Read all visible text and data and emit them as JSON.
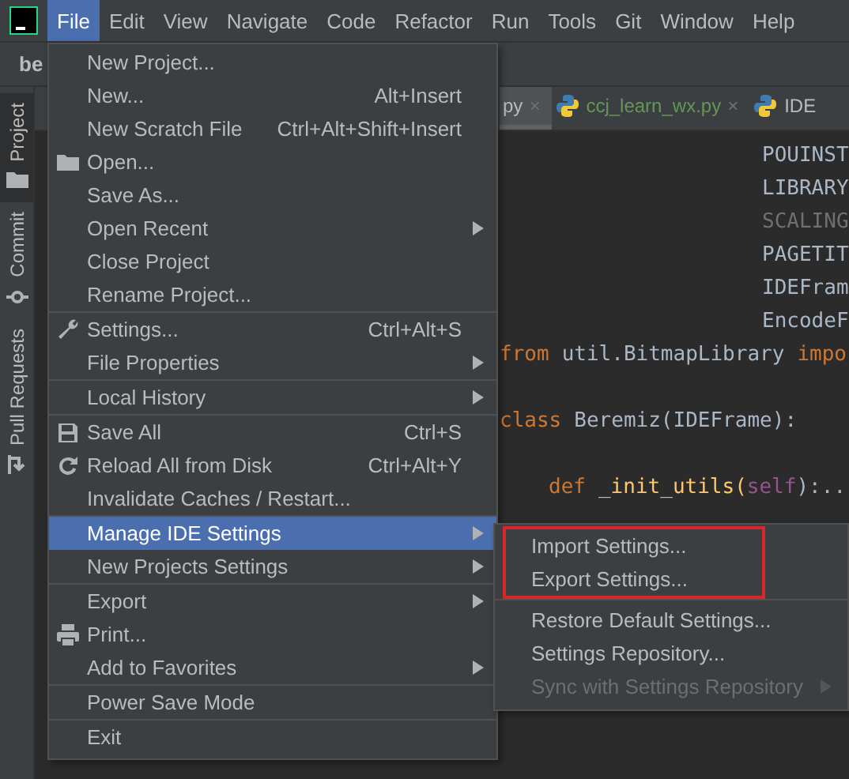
{
  "menubar": [
    {
      "label": "File",
      "selected": true
    },
    {
      "label": "Edit",
      "selected": false
    },
    {
      "label": "View",
      "selected": false
    },
    {
      "label": "Navigate",
      "selected": false
    },
    {
      "label": "Code",
      "selected": false
    },
    {
      "label": "Refactor",
      "selected": false
    },
    {
      "label": "Run",
      "selected": false
    },
    {
      "label": "Tools",
      "selected": false
    },
    {
      "label": "Git",
      "selected": false
    },
    {
      "label": "Window",
      "selected": false
    },
    {
      "label": "Help",
      "selected": false
    }
  ],
  "navbar": {
    "project": "be"
  },
  "sidebar": [
    {
      "label": "Project",
      "selected": true
    },
    {
      "label": "Commit",
      "selected": false
    },
    {
      "label": "Pull Requests",
      "selected": false
    }
  ],
  "tabs": [
    {
      "label": "py",
      "close": "×",
      "selected": true,
      "color": "#bbbbbb"
    },
    {
      "label": "ccj_learn_wx.py",
      "close": "×",
      "selected": false,
      "color": "#629755"
    },
    {
      "label": "IDE",
      "selected": false,
      "color": "#bbbbbb"
    }
  ],
  "code": [
    {
      "kind": "cut",
      "tokens": [
        {
          "kind": "plain",
          "text": "POUINST"
        }
      ]
    },
    {
      "kind": "cut",
      "tokens": [
        {
          "kind": "plain",
          "text": "LIBRARY"
        }
      ]
    },
    {
      "kind": "cut",
      "tokens": [
        {
          "kind": "dim",
          "text": "SCALING"
        }
      ]
    },
    {
      "kind": "cut",
      "tokens": [
        {
          "kind": "plain",
          "text": "PAGETIT"
        }
      ]
    },
    {
      "kind": "cut",
      "tokens": [
        {
          "kind": "plain",
          "text": "IDEFram"
        }
      ]
    },
    {
      "kind": "cut",
      "tokens": [
        {
          "kind": "plain",
          "text": "EncodeF"
        }
      ]
    },
    {
      "kind": "full",
      "tokens": [
        {
          "kind": "keyword",
          "text": "from"
        },
        {
          "kind": "plain",
          "text": "util.BitmapLibrary"
        },
        {
          "kind": "keyword",
          "text": "impo"
        }
      ]
    },
    {
      "kind": "blank"
    },
    {
      "kind": "full",
      "tokens": [
        {
          "kind": "keyword",
          "text": "class"
        },
        {
          "kind": "plain",
          "text": "Beremiz(IDEFrame):"
        }
      ]
    },
    {
      "kind": "blank"
    },
    {
      "kind": "indented",
      "tokens": [
        {
          "kind": "keyword",
          "text": "def"
        },
        {
          "kind": "fn",
          "text": "_init_utils("
        },
        {
          "kind": "self",
          "text": "self"
        },
        {
          "kind": "plain",
          "text": "):..."
        }
      ]
    }
  ],
  "file_menu": [
    [
      {
        "label": "New Project..."
      },
      {
        "label": "New...",
        "shortcut": "Alt+Insert"
      },
      {
        "label": "New Scratch File",
        "shortcut": "Ctrl+Alt+Shift+Insert"
      },
      {
        "label": "Open..."
      },
      {
        "label": "Save As..."
      },
      {
        "label": "Open Recent",
        "submenu": true
      },
      {
        "label": "Close Project"
      },
      {
        "label": "Rename Project..."
      }
    ],
    [
      {
        "label": "Settings...",
        "shortcut": "Ctrl+Alt+S"
      },
      {
        "label": "File Properties",
        "submenu": true
      }
    ],
    [
      {
        "label": "Local History",
        "submenu": true
      }
    ],
    [
      {
        "label": "Save All",
        "shortcut": "Ctrl+S"
      },
      {
        "label": "Reload All from Disk",
        "shortcut": "Ctrl+Alt+Y"
      },
      {
        "label": "Invalidate Caches / Restart..."
      }
    ],
    [
      {
        "label": "Manage IDE Settings",
        "submenu": true,
        "selected": true
      },
      {
        "label": "New Projects Settings",
        "submenu": true
      }
    ],
    [
      {
        "label": "Export",
        "submenu": true
      },
      {
        "label": "Print..."
      },
      {
        "label": "Add to Favorites",
        "submenu": true
      }
    ],
    [
      {
        "label": "Power Save Mode"
      }
    ],
    [
      {
        "label": "Exit"
      }
    ]
  ],
  "settings_submenu": [
    {
      "highlighted": true,
      "items": [
        {
          "label": "Import Settings..."
        },
        {
          "label": "Export Settings..."
        }
      ]
    },
    {
      "highlighted": false,
      "items": [
        {
          "label": "Restore Default Settings..."
        },
        {
          "label": "Settings Repository..."
        },
        {
          "label": "Sync with Settings Repository",
          "submenu": true,
          "disabled": true
        }
      ]
    }
  ]
}
